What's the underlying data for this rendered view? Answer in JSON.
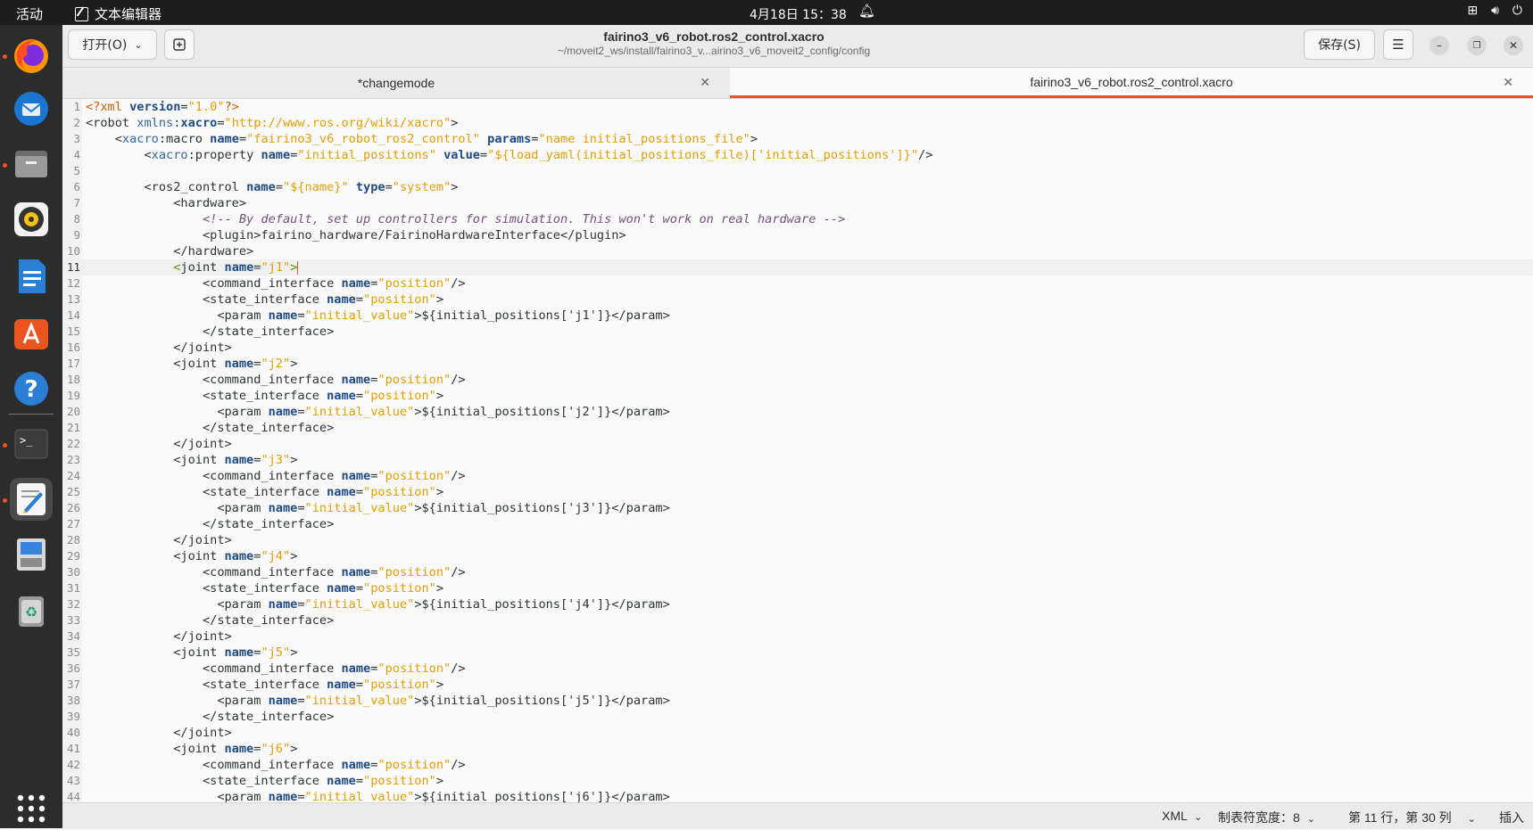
{
  "topbar": {
    "activities": "活动",
    "app_name": "文本编辑器",
    "clock": "4月18日  15：38"
  },
  "header": {
    "open_label": "打开(O)",
    "save_label": "保存(S)",
    "title": "fairino3_v6_robot.ros2_control.xacro",
    "subtitle": "~/moveit2_ws/install/fairino3_v...airino3_v6_moveit2_config/config"
  },
  "tabs": [
    {
      "label": "*changemode",
      "active": false
    },
    {
      "label": "fairino3_v6_robot.ros2_control.xacro",
      "active": true
    }
  ],
  "editor": {
    "current_line": 11,
    "lines": [
      "1",
      "2",
      "3",
      "4",
      "5",
      "6",
      "7",
      "8",
      "9",
      "10",
      "11",
      "12",
      "13",
      "14",
      "15",
      "16",
      "17",
      "18",
      "19",
      "20",
      "21",
      "22",
      "23",
      "24",
      "25",
      "26",
      "27",
      "28",
      "29",
      "30",
      "31",
      "32",
      "33",
      "34",
      "35",
      "36",
      "37",
      "38",
      "39",
      "40",
      "41",
      "42",
      "43",
      "44"
    ]
  },
  "statusbar": {
    "language": "XML",
    "tab_width": "制表符宽度：8",
    "position": "第 11 行，第 30 列",
    "mode": "插入"
  },
  "dock": {
    "items": [
      "firefox-icon",
      "thunderbird-icon",
      "files-icon",
      "rhythmbox-icon",
      "writer-icon",
      "app-center-icon",
      "help-icon",
      "terminal-icon",
      "text-editor-icon",
      "disk-icon",
      "trash-icon",
      "show-apps-icon"
    ]
  }
}
